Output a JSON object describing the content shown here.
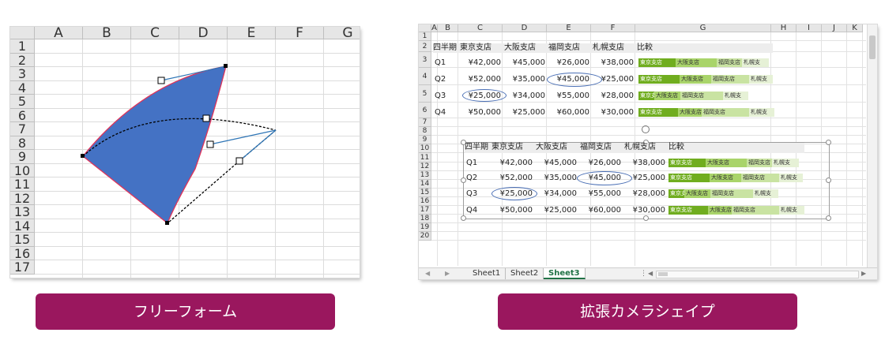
{
  "left_sheet": {
    "columns": [
      "A",
      "B",
      "C",
      "D",
      "E",
      "F",
      "G"
    ],
    "rows": [
      "1",
      "2",
      "3",
      "4",
      "5",
      "6",
      "7",
      "8",
      "9",
      "10",
      "11",
      "12",
      "13",
      "14",
      "15",
      "16",
      "17"
    ],
    "shape_fill": "#4472c4",
    "shape_outline": "#e0345a",
    "shape_name": "freeform-shape"
  },
  "right_sheet": {
    "columns": [
      "A",
      "B",
      "C",
      "D",
      "E",
      "F",
      "G",
      "H",
      "I",
      "J",
      "K"
    ],
    "rows": [
      "1",
      "2",
      "3",
      "4",
      "5",
      "6",
      "7",
      "8",
      "9",
      "10",
      "11",
      "12",
      "13",
      "14",
      "15",
      "16",
      "17",
      "18",
      "19",
      "20"
    ],
    "table_headers": [
      "四半期",
      "東京支店",
      "大阪支店",
      "福岡支店",
      "札幌支店",
      "比較"
    ],
    "table_rows": [
      {
        "q": "Q1",
        "tokyo": "¥42,000",
        "osaka": "¥45,000",
        "fukuoka": "¥26,000",
        "sapporo": "¥38,000"
      },
      {
        "q": "Q2",
        "tokyo": "¥52,000",
        "osaka": "¥35,000",
        "fukuoka": "¥45,000",
        "sapporo": "¥25,000"
      },
      {
        "q": "Q3",
        "tokyo": "¥25,000",
        "osaka": "¥34,000",
        "fukuoka": "¥55,000",
        "sapporo": "¥28,000"
      },
      {
        "q": "Q4",
        "tokyo": "¥50,000",
        "osaka": "¥25,000",
        "fukuoka": "¥60,000",
        "sapporo": "¥30,000"
      }
    ],
    "bar_labels": [
      "東京支店",
      "大阪支店",
      "福岡支店",
      "札幌支"
    ],
    "bar_colors": [
      "#70ad1f",
      "#a9d46a",
      "#c9e3a2",
      "#e6f1d6"
    ],
    "circle_color": "#4a6fb5",
    "sheet_tabs": [
      "Sheet1",
      "Sheet2",
      "Sheet3"
    ],
    "active_tab": "Sheet3",
    "accent": "#217346"
  },
  "labels": {
    "left": "フリーフォーム",
    "right": "拡張カメラシェイプ"
  },
  "label_color": "#9a175e"
}
